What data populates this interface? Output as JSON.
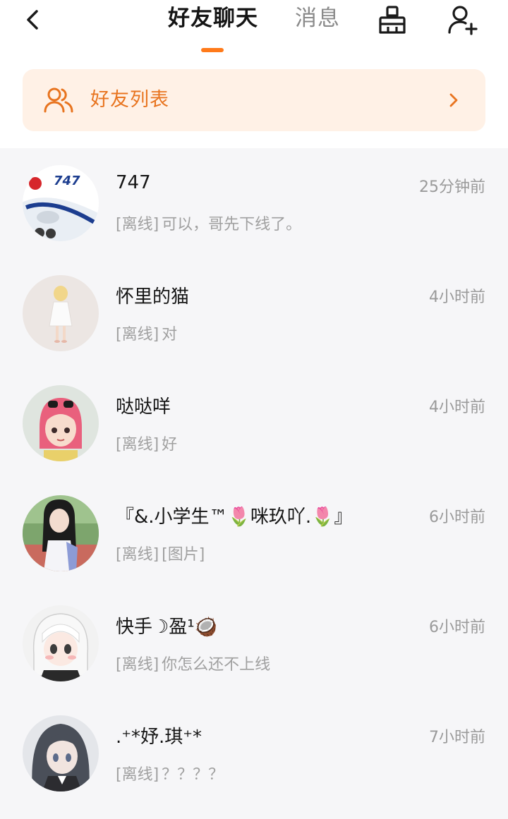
{
  "header": {
    "tabs": [
      {
        "label": "好友聊天",
        "active": true
      },
      {
        "label": "消息",
        "active": false
      }
    ],
    "accent_color": "#ff7a1a",
    "icons": [
      "back-arrow-icon",
      "broom-clean-icon",
      "add-friend-icon"
    ]
  },
  "friends_banner": {
    "label": "好友列表",
    "icon": "friends-group-icon",
    "background": "#fff1e6",
    "text_color": "#e8741f"
  },
  "chats": [
    {
      "name": "747",
      "time": "25分钟前",
      "status": "[离线]",
      "preview": "可以，哥先下线了。",
      "avatar": "airplane-avatar"
    },
    {
      "name": "怀里的猫",
      "time": "4小时前",
      "status": "[离线]",
      "preview": "对",
      "avatar": "figure-white-dress-avatar"
    },
    {
      "name": "哒哒咩",
      "time": "4小时前",
      "status": "[离线]",
      "preview": "好",
      "avatar": "pink-hair-girl-avatar"
    },
    {
      "name": "『&.小学生™🌷咪玖吖.🌷』",
      "time": "6小时前",
      "status": "[离线]",
      "preview": "[图片]",
      "avatar": "girl-photo-avatar"
    },
    {
      "name": "快手☽盈¹🥥",
      "time": "6小时前",
      "status": "[离线]",
      "preview": "你怎么还不上线",
      "avatar": "white-hair-anime-avatar"
    },
    {
      "name": ".⁺*妤.琪⁺*",
      "time": "7小时前",
      "status": "[离线]",
      "preview": "？？？？",
      "avatar": "dark-hair-anime-avatar"
    }
  ]
}
